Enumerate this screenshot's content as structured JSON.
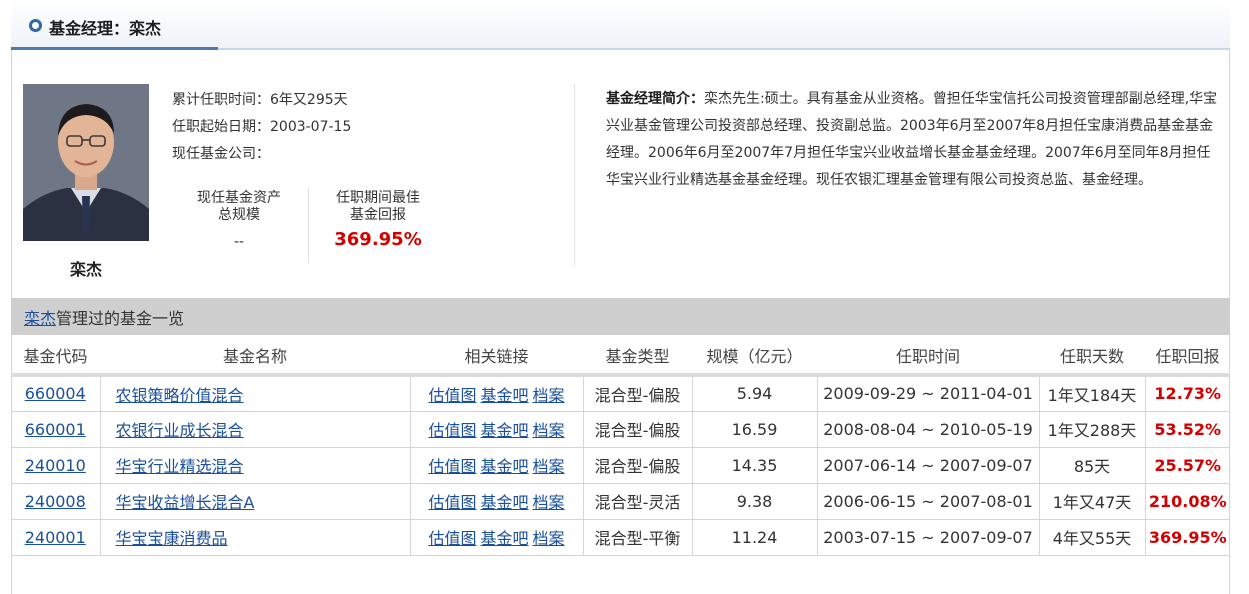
{
  "header": {
    "title": "基金经理：栾杰"
  },
  "manager": {
    "name": "栾杰",
    "tenure_label": "累计任职时间：",
    "tenure_value": "6年又295天",
    "start_label": "任职起始日期：",
    "start_value": "2003-07-15",
    "company_label": "现任基金公司："
  },
  "stats": {
    "assets_label_1": "现任基金资产",
    "assets_label_2": "总规模",
    "assets_value": "--",
    "best_label_1": "任职期间最佳",
    "best_label_2": "基金回报",
    "best_value": "369.95%"
  },
  "bio": {
    "label": "基金经理简介：",
    "text": "栾杰先生:硕士。具有基金从业资格。曾担任华宝信托公司投资管理部副总经理,华宝兴业基金管理公司投资部总经理、投资副总监。2003年6月至2007年8月担任宝康消费品基金基金经理。2006年6月至2007年7月担任华宝兴业收益增长基金基金经理。2007年6月至同年8月担任华宝兴业行业精选基金基金经理。现任农银汇理基金管理有限公司投资总监、基金经理。"
  },
  "list": {
    "name_link": "栾杰",
    "title_suffix": "管理过的基金一览"
  },
  "table": {
    "headers": [
      "基金代码",
      "基金名称",
      "相关链接",
      "基金类型",
      "规模（亿元）",
      "任职时间",
      "任职天数",
      "任职回报"
    ],
    "link_labels": [
      "估值图",
      "基金吧",
      "档案"
    ],
    "rows": [
      {
        "code": "660004",
        "name": "农银策略价值混合",
        "type": "混合型-偏股",
        "size": "5.94",
        "period": "2009-09-29 ~ 2011-04-01",
        "days": "1年又184天",
        "ret": "12.73%"
      },
      {
        "code": "660001",
        "name": "农银行业成长混合",
        "type": "混合型-偏股",
        "size": "16.59",
        "period": "2008-08-04 ~ 2010-05-19",
        "days": "1年又288天",
        "ret": "53.52%"
      },
      {
        "code": "240010",
        "name": "华宝行业精选混合",
        "type": "混合型-偏股",
        "size": "14.35",
        "period": "2007-06-14 ~ 2007-09-07",
        "days": "85天",
        "ret": "25.57%"
      },
      {
        "code": "240008",
        "name": "华宝收益增长混合A",
        "type": "混合型-灵活",
        "size": "9.38",
        "period": "2006-06-15 ~ 2007-08-01",
        "days": "1年又47天",
        "ret": "210.08%"
      },
      {
        "code": "240001",
        "name": "华宝宝康消费品",
        "type": "混合型-平衡",
        "size": "11.24",
        "period": "2003-07-15 ~ 2007-09-07",
        "days": "4年又55天",
        "ret": "369.95%"
      }
    ]
  }
}
